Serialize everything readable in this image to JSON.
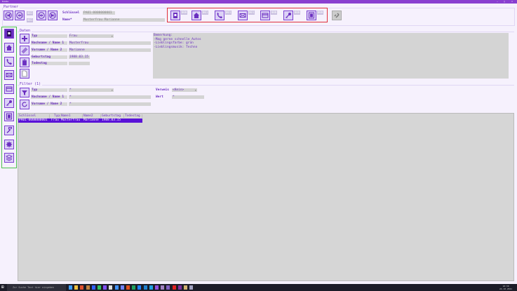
{
  "window": {
    "title": "Kunde",
    "min": "–",
    "max": "□",
    "close": "✕"
  },
  "partner": {
    "group_label": "Partner",
    "counter_top": "001",
    "counter_bottom": "001",
    "schluessel_label": "Schlüssel",
    "schluessel_value": "PA01-0000000001",
    "name_label": "Name*",
    "name_value": "Musterfrau Marianne"
  },
  "categories": [
    {
      "icon": "contact-card-icon",
      "count": "000"
    },
    {
      "icon": "home-icon",
      "count": "001"
    },
    {
      "icon": "phone-icon",
      "count": "001"
    },
    {
      "icon": "mail-icon",
      "count": "001"
    },
    {
      "icon": "credit-card-icon",
      "count": "000"
    },
    {
      "icon": "key-icon",
      "count": "000"
    },
    {
      "icon": "document-icon",
      "count": "000"
    }
  ],
  "daten": {
    "group_label": "Daten",
    "typ_label": "Typ",
    "typ_value": "Frau",
    "nachname_label": "Nachname / Name 1",
    "nachname_value": "Musterfrau",
    "vorname_label": "Vorname  / Name 2",
    "vorname_value": "Marianne",
    "geburtstag_label": "Geburtstag",
    "geburtstag_value": "1988.03.15",
    "todestag_label": "Todestag",
    "todestag_value": "",
    "bemerkung": "Bemerkung:\n-Mag gerne schnelle Autos\n-Lieblingsfarbe: grün\n-Lieblingsmusik: Techno"
  },
  "filter": {
    "group_label": "Filter (1)",
    "typ_label": "Typ",
    "typ_value": "*",
    "nachname_label": "Nachname / Name 1",
    "nachname_value": "*",
    "vorname_label": "Vorname  / Name 2",
    "vorname_value": "*",
    "verweis_label": "Verweis",
    "verweis_value": "<Kein>",
    "wert_label": "Wert",
    "wert_value": "*"
  },
  "table": {
    "headers": [
      "Schlüssel",
      "Typ",
      "Name1",
      "Name2",
      "Geburtstag",
      "Todestag"
    ],
    "rows": [
      [
        "PA01-0000000001",
        "Frau",
        "Musterfrau",
        "Marianne",
        "1988.03.15",
        ""
      ]
    ]
  },
  "taskbar": {
    "search_placeholder": "Zur Suche Text hier eingeben",
    "time": "10:30",
    "date": "24.10.2021"
  }
}
